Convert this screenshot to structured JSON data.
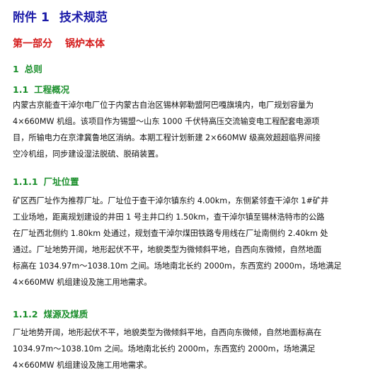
{
  "annex": {
    "prefix": "附件",
    "number": "1",
    "title": "技术规范"
  },
  "part": {
    "label": "第一部分",
    "subject": "锅炉本体"
  },
  "sec1": {
    "number": "1",
    "title": "总则"
  },
  "sec1_1": {
    "number": "1.1",
    "title": "工程概况"
  },
  "para1": {
    "lines": [
      "内蒙古京能查干淖尔电厂位于内蒙古自治区锡林郭勒盟阿巴嘎旗境内，电厂规划容量为",
      "4×660MW 机组。该项目作为锡盟～山东 1000 千伏特高压交流输变电工程配套电源项",
      "目，所输电力在京津冀鲁地区消纳。本期工程计划新建 2×660MW 级高效超超临界间接",
      "空冷机组，同步建设湿法脱硫、脱硝装置。"
    ]
  },
  "sec1_1_1": {
    "number": "1.1.1",
    "title": "厂址位置"
  },
  "para2": {
    "lines": [
      "矿区西厂址作为推荐厂址。厂址位于查干淖尔镇东约 4.00km，东侧紧邻查干淖尔 1#矿井",
      "工业场地，距离规划建设的井田 1 号主井口约 1.50km，查干淖尔镇至锡林浩特市的公路",
      "在厂址西北侧约 1.80km 处通过，规划查干淖尔煤田铁路专用线在厂址南侧约 2.40km 处",
      "通过。厂址地势开阔，地形起伏不平，地貌类型为微倾斜平地，自西向东微倾，自然地面",
      "标高在 1034.97m～1038.10m 之间。场地南北长约 2000m，东西宽约 2000m，场地满足",
      "4×660MW 机组建设及施工用地需求。"
    ]
  },
  "sec1_1_2": {
    "number": "1.1.2",
    "title": "煤源及煤质"
  },
  "para3": {
    "lines": [
      "厂址地势开阔，地形起伏不平，地貌类型为微倾斜平地，自西向东微倾，自然地面标高在",
      "1034.97m～1038.10m 之间。场地南北长约 2000m，东西宽约 2000m，场地满足",
      "4×660MW 机组建设及施工用地需求。"
    ]
  },
  "colors": {
    "annex_heading": "#1a1aa8",
    "part_heading": "#d41a1a",
    "section_heading": "#1b8f2c",
    "body_text": "#111111"
  }
}
